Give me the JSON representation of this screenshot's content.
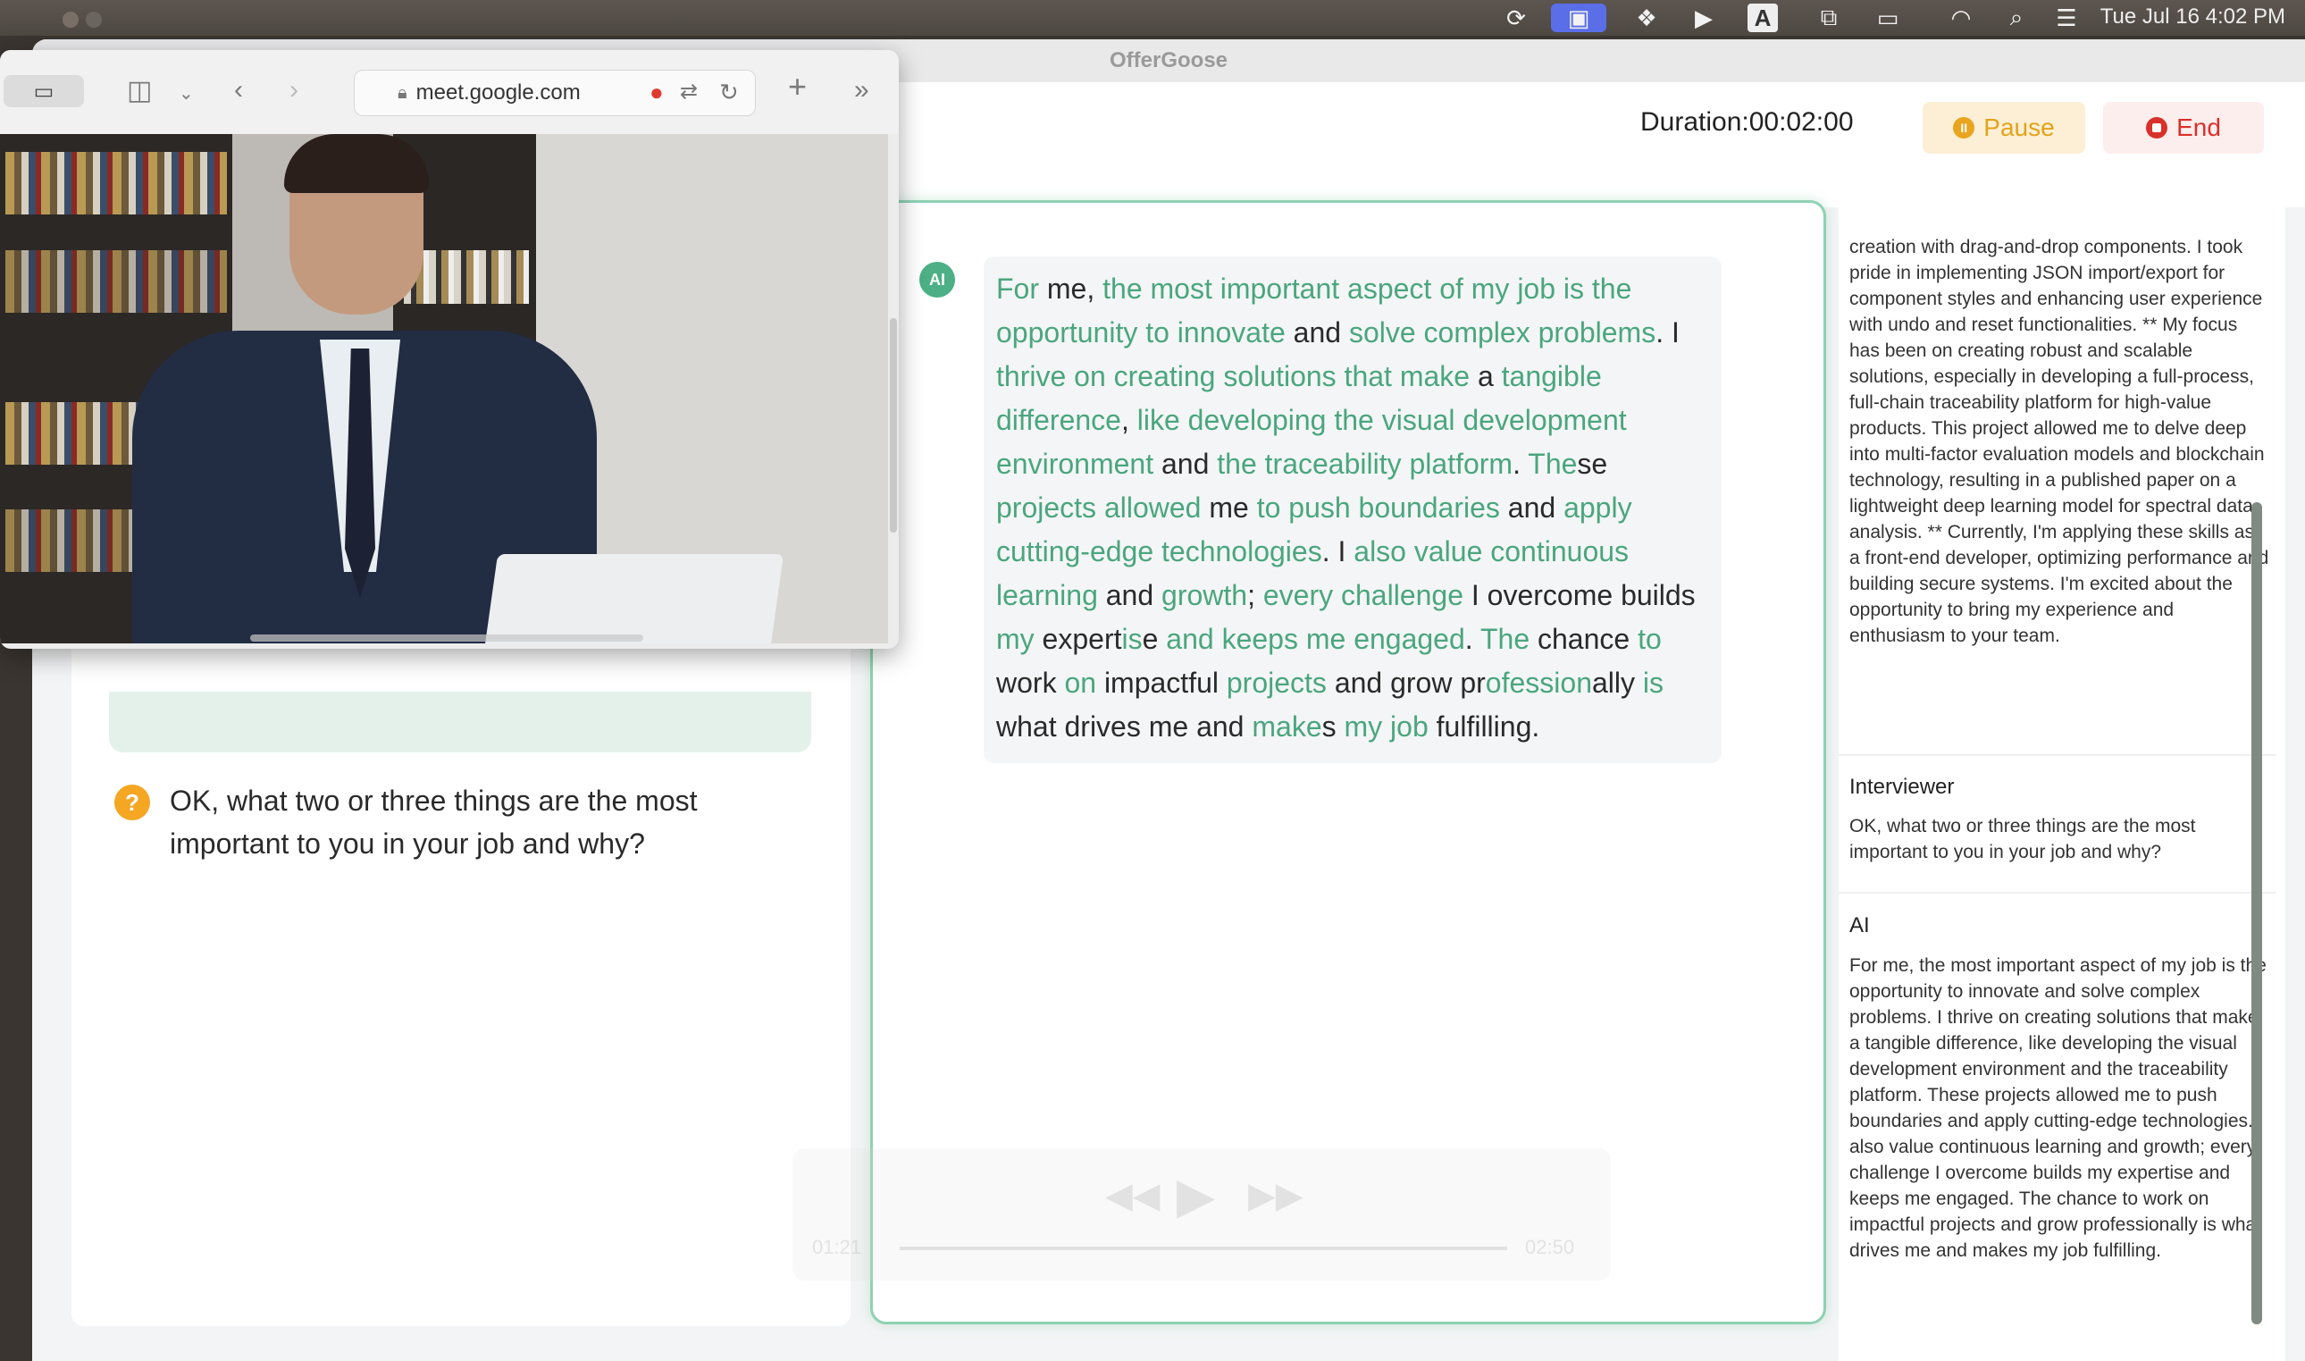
{
  "menubar": {
    "clock": "Tue Jul 16  4:02 PM",
    "icons": [
      "apple-icon",
      "sync-icon",
      "screen-share-icon",
      "bookmark-icon",
      "play-icon",
      "keyboard-a-icon",
      "windows-icon",
      "battery-icon",
      "wifi-icon",
      "search-icon",
      "control-center-icon"
    ],
    "keyboard_label": "A"
  },
  "app": {
    "title": "OfferGoose",
    "duration": "Duration:00:02:00",
    "pause_label": "Pause",
    "end_label": "End",
    "accent_green": "#4aa67e",
    "pause_color": "#e3a21a",
    "end_color": "#d9302a"
  },
  "left_panel": {
    "question": "OK,   what two or three things are the most important to you in your job and why?"
  },
  "center_panel": {
    "ai_badge": "AI",
    "answer_segments": [
      {
        "t": "For",
        "g": true
      },
      {
        "t": " me, ",
        "g": false
      },
      {
        "t": "the most important aspect of my job is the opportunity to innovate",
        "g": true
      },
      {
        "t": " and ",
        "g": false
      },
      {
        "t": "solve complex problems",
        "g": true
      },
      {
        "t": ". I ",
        "g": false
      },
      {
        "t": "thrive on creating solutions that make",
        "g": true
      },
      {
        "t": " a ",
        "g": false
      },
      {
        "t": "tangible difference",
        "g": true
      },
      {
        "t": ", ",
        "g": false
      },
      {
        "t": "like developing the visual development environment",
        "g": true
      },
      {
        "t": " and ",
        "g": false
      },
      {
        "t": "the traceability platform",
        "g": true
      },
      {
        "t": ". ",
        "g": false
      },
      {
        "t": "The",
        "g": true
      },
      {
        "t": "se ",
        "g": false
      },
      {
        "t": "projects allowed",
        "g": true
      },
      {
        "t": " me ",
        "g": false
      },
      {
        "t": "to push boundaries",
        "g": true
      },
      {
        "t": " and ",
        "g": false
      },
      {
        "t": "apply cutting-edge technologies",
        "g": true
      },
      {
        "t": ". I ",
        "g": false
      },
      {
        "t": "also value continuous learning",
        "g": true
      },
      {
        "t": " and ",
        "g": false
      },
      {
        "t": "growth",
        "g": true
      },
      {
        "t": "; ",
        "g": false
      },
      {
        "t": "every challenge",
        "g": true
      },
      {
        "t": " I overcome builds ",
        "g": false
      },
      {
        "t": "my",
        "g": true
      },
      {
        "t": " expert",
        "g": false
      },
      {
        "t": "is",
        "g": true
      },
      {
        "t": "e ",
        "g": false
      },
      {
        "t": "and keeps me engaged",
        "g": true
      },
      {
        "t": ". ",
        "g": false
      },
      {
        "t": "The",
        "g": true
      },
      {
        "t": " chance ",
        "g": false
      },
      {
        "t": "to",
        "g": true
      },
      {
        "t": " work ",
        "g": false
      },
      {
        "t": "on",
        "g": true
      },
      {
        "t": " impactful ",
        "g": false
      },
      {
        "t": "projects",
        "g": true
      },
      {
        "t": " and grow pr",
        "g": false
      },
      {
        "t": "ofessi",
        "g": true
      },
      {
        "t": "on",
        "g": true
      },
      {
        "t": "ally ",
        "g": false
      },
      {
        "t": "is",
        "g": true
      },
      {
        "t": " what drives me and ",
        "g": false
      },
      {
        "t": "make",
        "g": true
      },
      {
        "t": "s ",
        "g": false
      },
      {
        "t": "my job",
        "g": true
      },
      {
        "t": " fulfilling.",
        "g": false
      }
    ],
    "player": {
      "time_elapsed": "01:21",
      "time_total": "02:50"
    }
  },
  "right_panel": {
    "previous_text": "creation with drag-and-drop components. I took pride in implementing JSON import/export for component styles and enhancing user experience with undo and reset functionalities. ** My focus has been on creating robust and scalable solutions, especially in developing a full-process, full-chain traceability platform for high-value products. This project allowed me to delve deep into multi-factor evaluation models and blockchain technology, resulting in a published paper on a lightweight deep learning model for spectral data analysis. ** Currently, I'm applying these skills as a front-end developer, optimizing performance and building secure systems. I'm excited about the opportunity to bring my experience and enthusiasm to your team.",
    "interviewer_label": "Interviewer",
    "interviewer_text": "OK,  what two or three things are the most important to you in your job and why?",
    "ai_label": "AI",
    "ai_text": "For me, the most important aspect of my job is the opportunity to innovate and solve complex problems. I thrive on creating solutions that make a tangible difference, like developing the visual development environment and the traceability platform. These projects allowed me to push boundaries and apply cutting-edge technologies. I also value continuous learning and growth; every challenge I overcome builds my expertise and keeps me engaged. The chance to work on impactful projects and grow professionally is what drives me and makes my job fulfilling."
  },
  "safari": {
    "url": "meet.google.com"
  }
}
